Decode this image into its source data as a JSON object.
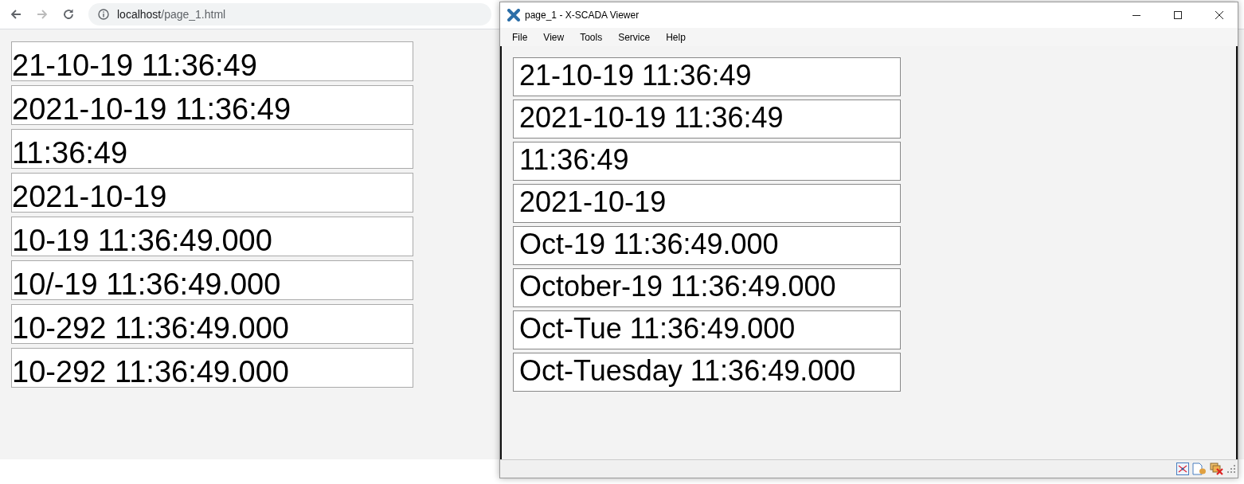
{
  "browser": {
    "address_host": "localhost",
    "address_path": "/page_1.html",
    "back_enabled": true,
    "forward_enabled": false,
    "fields": [
      "21-10-19 11:36:49",
      "2021-10-19 11:36:49",
      "11:36:49",
      "2021-10-19",
      "10-19 11:36:49.000",
      "10/-19 11:36:49.000",
      "10-292 11:36:49.000",
      "10-292 11:36:49.000"
    ]
  },
  "viewer": {
    "window": {
      "title": "page_1 - X-SCADA Viewer"
    },
    "menu": [
      "File",
      "View",
      "Tools",
      "Service",
      "Help"
    ],
    "fields": [
      "21-10-19 11:36:49",
      "2021-10-19 11:36:49",
      "11:36:49",
      "2021-10-19",
      "Oct-19 11:36:49.000",
      "October-19 11:36:49.000",
      "Oct-Tue 11:36:49.000",
      "Oct-Tuesday 11:36:49.000"
    ]
  }
}
